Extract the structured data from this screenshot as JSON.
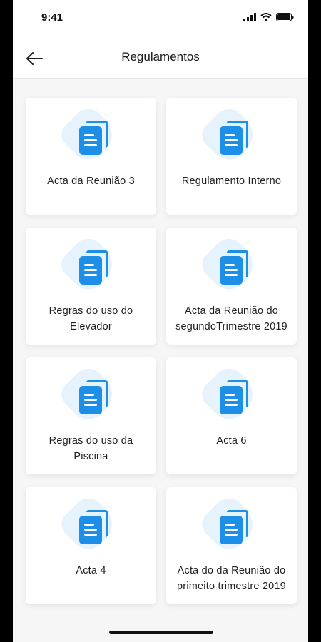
{
  "status_bar": {
    "time": "9:41",
    "icons": [
      "signal-icon",
      "wifi-icon",
      "battery-icon"
    ]
  },
  "header": {
    "back_icon": "arrow-left-icon",
    "title": "Regulamentos"
  },
  "colors": {
    "accent": "#1e8fe6",
    "icon_background": "#e7f3fc",
    "page_background": "#f6f6f6",
    "card_background": "#ffffff"
  },
  "documents": [
    {
      "label": "Acta da Reunião 3",
      "icon": "document-icon"
    },
    {
      "label": "Regulamento Interno",
      "icon": "document-icon"
    },
    {
      "label": "Regras do uso do Elevador",
      "icon": "document-icon"
    },
    {
      "label": "Acta da Reunião do segundoTrimestre 2019",
      "icon": "document-icon"
    },
    {
      "label": "Regras do uso da Piscina",
      "icon": "document-icon"
    },
    {
      "label": "Acta 6",
      "icon": "document-icon"
    },
    {
      "label": "Acta 4",
      "icon": "document-icon"
    },
    {
      "label": "Acta do da Reunião do primeito trimestre 2019",
      "icon": "document-icon"
    }
  ]
}
